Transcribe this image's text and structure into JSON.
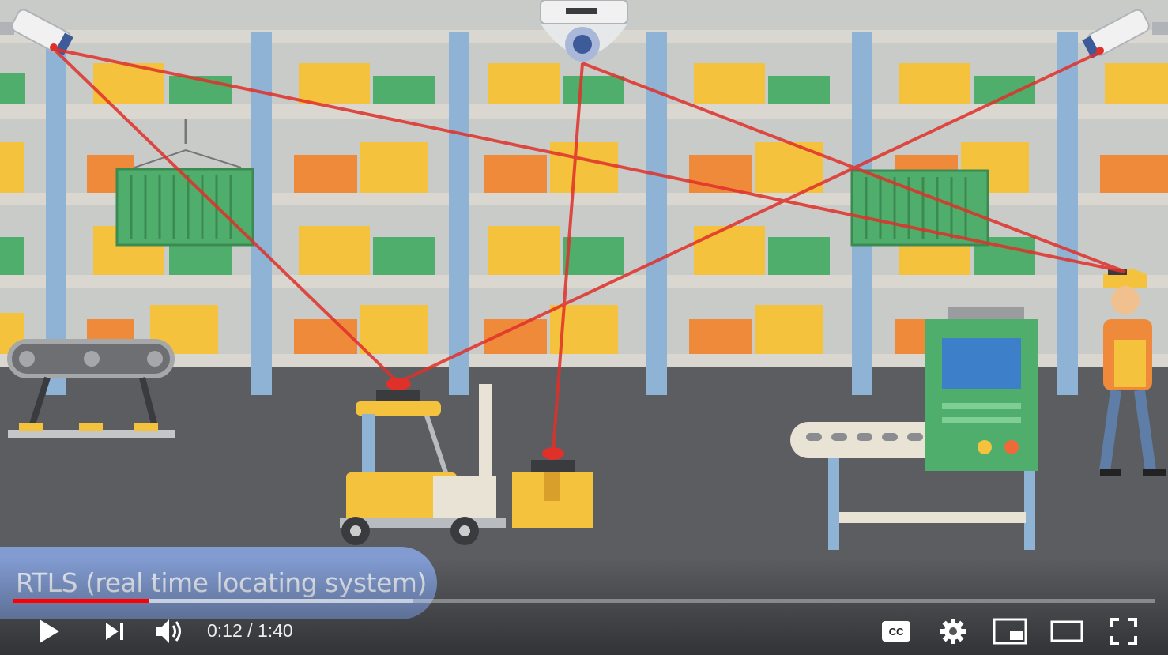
{
  "video": {
    "subtitle": "RTLS (real time locating system)",
    "progress_fraction": 0.119,
    "buffered_fraction": 0.35
  },
  "controls": {
    "current_time": "0:12",
    "separator": "/",
    "duration": "1:40",
    "icons": {
      "play": "play-icon",
      "next": "next-icon",
      "volume": "volume-icon",
      "captions": "cc-icon",
      "settings": "gear-icon",
      "miniplayer": "miniplayer-icon",
      "theater": "theater-icon",
      "fullscreen": "fullscreen-icon"
    }
  },
  "colors": {
    "progress_played": "#ff0000",
    "laser": "#e0302a",
    "wall": "#c9cbc8",
    "floor": "#5b5d61",
    "rack_post": "#8fb3d4",
    "box_yellow": "#f4c23c",
    "box_green": "#4fae6b",
    "box_orange": "#ef8a3a",
    "caption_bg": "#87a5e1"
  }
}
